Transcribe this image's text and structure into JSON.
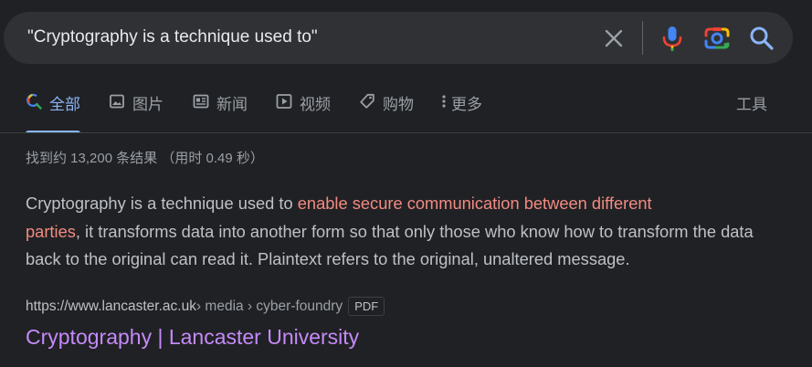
{
  "search": {
    "query": "\"Cryptography is a technique used to\""
  },
  "tabs": [
    {
      "label": "全部",
      "icon": "search-icon"
    },
    {
      "label": "图片",
      "icon": "image-icon"
    },
    {
      "label": "新闻",
      "icon": "news-icon"
    },
    {
      "label": "视频",
      "icon": "video-icon"
    },
    {
      "label": "购物",
      "icon": "tag-icon"
    },
    {
      "label": "更多",
      "icon": "more-vertical-icon"
    }
  ],
  "tools_label": "工具",
  "stats": "找到约 13,200 条结果 （用时 0.49 秒）",
  "result": {
    "snippet_before": "Cryptography is a technique used to ",
    "snippet_highlight_1": "enable secure communication between different",
    "snippet_highlight_2": "parties",
    "snippet_after": ", it transforms data into another form so that only those who know how to transform the data back to the original can read it. Plaintext refers to the original, unaltered message.",
    "url_domain": "https://www.lancaster.ac.uk",
    "url_path": " › media › cyber-foundry",
    "file_type": "PDF",
    "title": "Cryptography | Lancaster University"
  },
  "colors": {
    "background": "#202124",
    "searchbar": "#303134",
    "active_tab": "#8ab4f8",
    "highlight": "#f28b82",
    "visited_link": "#c58af9"
  }
}
